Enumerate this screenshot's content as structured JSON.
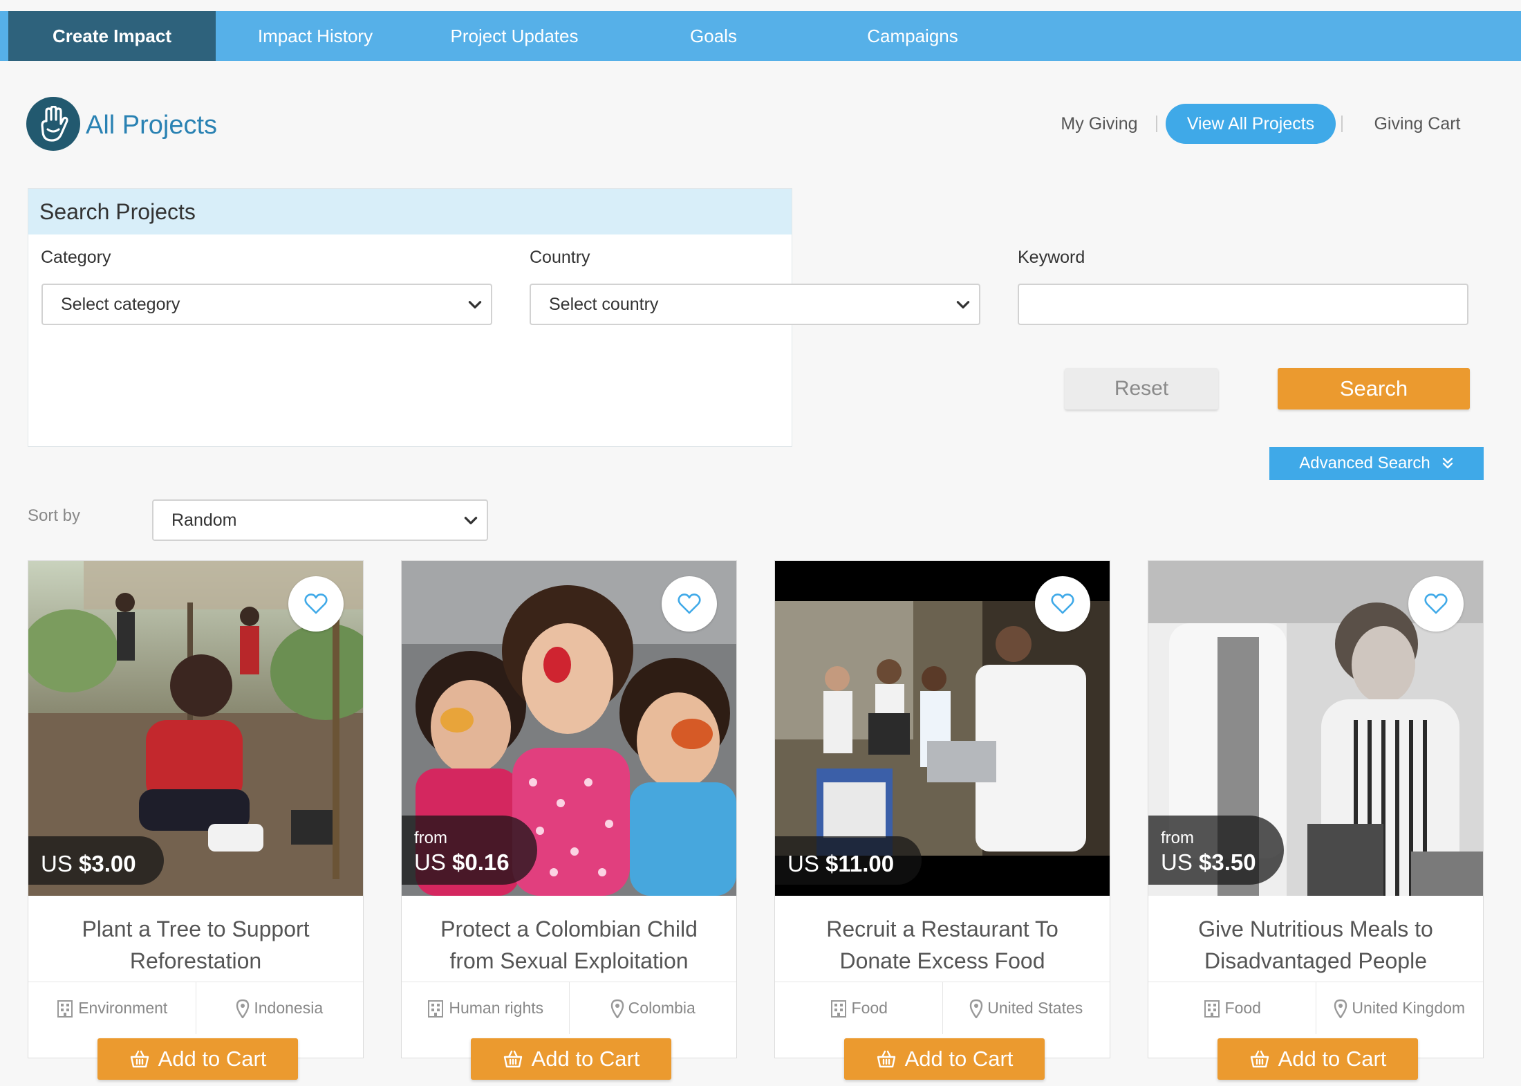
{
  "topnav": {
    "tabs": [
      {
        "label": "Create Impact",
        "active": true
      },
      {
        "label": "Impact History",
        "active": false
      },
      {
        "label": "Project Updates",
        "active": false
      },
      {
        "label": "Goals",
        "active": false
      },
      {
        "label": "Campaigns",
        "active": false
      }
    ]
  },
  "header": {
    "title": "All Projects",
    "subnav": [
      {
        "label": "My Giving",
        "active": false
      },
      {
        "label": "View All Projects",
        "active": true
      },
      {
        "label": "Giving Cart",
        "active": false
      }
    ]
  },
  "search": {
    "heading": "Search Projects",
    "category_label": "Category",
    "category_value": "Select category",
    "country_label": "Country",
    "country_value": "Select country",
    "keyword_label": "Keyword",
    "keyword_value": "",
    "reset_label": "Reset",
    "search_label": "Search",
    "advanced_label": "Advanced Search"
  },
  "sort": {
    "label": "Sort by",
    "value": "Random"
  },
  "cards": [
    {
      "from": "",
      "currency": "US",
      "amount": "$3.00",
      "title": "Plant a Tree to Support Reforestation",
      "category": "Environment",
      "country": "Indonesia",
      "cart_label": "Add to Cart"
    },
    {
      "from": "from",
      "currency": "US",
      "amount": "$0.16",
      "title": "Protect a Colombian Child from Sexual Exploitation",
      "category": "Human rights",
      "country": "Colombia",
      "cart_label": "Add to Cart"
    },
    {
      "from": "",
      "currency": "US",
      "amount": "$11.00",
      "title": "Recruit a Restaurant To Donate Excess Food",
      "category": "Food",
      "country": "United States",
      "cart_label": "Add to Cart"
    },
    {
      "from": "from",
      "currency": "US",
      "amount": "$3.50",
      "title": "Give Nutritious Meals to Disadvantaged People",
      "category": "Food",
      "country": "United Kingdom",
      "cart_label": "Add to Cart"
    }
  ],
  "colors": {
    "nav_bg": "#56b0e8",
    "nav_active": "#2e627c",
    "accent_blue": "#3fa9e8",
    "accent_orange": "#eb9a2f",
    "title_blue": "#2a82b3"
  },
  "icons": [
    "hand-logo-icon",
    "chevron-down-icon",
    "double-chevron-down-icon",
    "heart-icon",
    "building-icon",
    "map-pin-icon",
    "basket-icon"
  ]
}
